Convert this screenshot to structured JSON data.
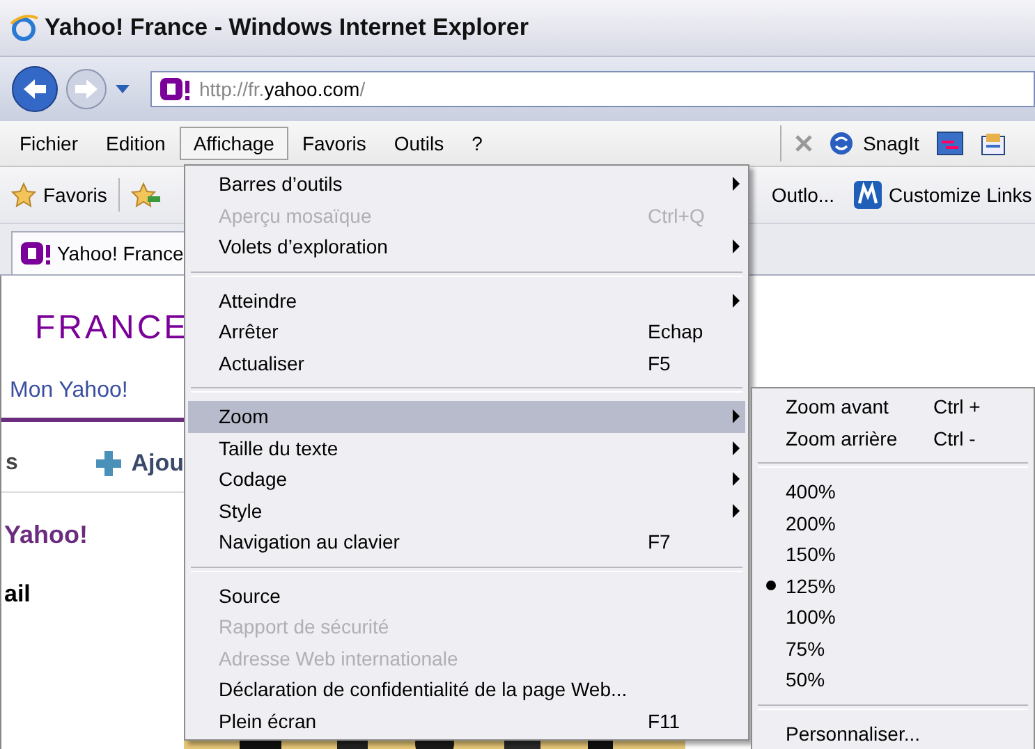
{
  "window": {
    "title": "Yahoo! France - Windows Internet Explorer"
  },
  "address_bar": {
    "scheme": "http://fr.",
    "domain": "yahoo.com",
    "path": "/"
  },
  "menu_bar": [
    {
      "label": "Fichier",
      "selected": false
    },
    {
      "label": "Edition",
      "selected": false
    },
    {
      "label": "Affichage",
      "selected": true
    },
    {
      "label": "Favoris",
      "selected": false
    },
    {
      "label": "Outils",
      "selected": false
    },
    {
      "label": "?",
      "selected": false
    }
  ],
  "toolbar": {
    "snagit_label": "SnagIt"
  },
  "favorites_bar": {
    "favorites_label": "Favoris",
    "links": [
      "Outlo...",
      "Customize Links"
    ]
  },
  "tabs": [
    {
      "label": "Yahoo! France",
      "selected": true
    }
  ],
  "page": {
    "logo_subtitle": "FRANCE",
    "nav_link": "Mon Yahoo!",
    "fragment": "s",
    "add_button": "Ajou",
    "heading": "Yahoo!",
    "label": "ail"
  },
  "view_menu": {
    "items": [
      {
        "kind": "item",
        "label": "Barres d’outils",
        "submenu": true,
        "disabled": false,
        "selected": false
      },
      {
        "kind": "item",
        "label": "Aperçu mosaïque",
        "shortcut": "Ctrl+Q",
        "submenu": false,
        "disabled": true,
        "selected": false
      },
      {
        "kind": "item",
        "label": "Volets d’exploration",
        "submenu": true,
        "disabled": false,
        "selected": false
      },
      {
        "kind": "separator"
      },
      {
        "kind": "item",
        "label": "Atteindre",
        "submenu": true,
        "disabled": false,
        "selected": false
      },
      {
        "kind": "item",
        "label": "Arrêter",
        "shortcut": "Echap",
        "submenu": false,
        "disabled": false,
        "selected": false
      },
      {
        "kind": "item",
        "label": "Actualiser",
        "shortcut": "F5",
        "submenu": false,
        "disabled": false,
        "selected": false
      },
      {
        "kind": "separator"
      },
      {
        "kind": "item",
        "label": "Zoom",
        "submenu": true,
        "disabled": false,
        "selected": true
      },
      {
        "kind": "item",
        "label": "Taille du texte",
        "submenu": true,
        "disabled": false,
        "selected": false
      },
      {
        "kind": "item",
        "label": "Codage",
        "submenu": true,
        "disabled": false,
        "selected": false
      },
      {
        "kind": "item",
        "label": "Style",
        "submenu": true,
        "disabled": false,
        "selected": false
      },
      {
        "kind": "item",
        "label": "Navigation au clavier",
        "shortcut": "F7",
        "submenu": false,
        "disabled": false,
        "selected": false
      },
      {
        "kind": "separator"
      },
      {
        "kind": "item",
        "label": "Source",
        "submenu": false,
        "disabled": false,
        "selected": false
      },
      {
        "kind": "item",
        "label": "Rapport de sécurité",
        "submenu": false,
        "disabled": true,
        "selected": false
      },
      {
        "kind": "item",
        "label": "Adresse Web internationale",
        "submenu": false,
        "disabled": true,
        "selected": false
      },
      {
        "kind": "item",
        "label": "Déclaration de confidentialité de la page Web...",
        "submenu": false,
        "disabled": false,
        "selected": false
      },
      {
        "kind": "item",
        "label": "Plein écran",
        "shortcut": "F11",
        "submenu": false,
        "disabled": false,
        "selected": false
      }
    ]
  },
  "zoom_submenu": {
    "items": [
      {
        "kind": "item",
        "label": "Zoom avant",
        "shortcut": "Ctrl +",
        "checked": false
      },
      {
        "kind": "item",
        "label": "Zoom arrière",
        "shortcut": "Ctrl -",
        "checked": false
      },
      {
        "kind": "separator"
      },
      {
        "kind": "item",
        "label": "400%",
        "checked": false
      },
      {
        "kind": "item",
        "label": "200%",
        "checked": false
      },
      {
        "kind": "item",
        "label": "150%",
        "checked": false
      },
      {
        "kind": "item",
        "label": "125%",
        "checked": true
      },
      {
        "kind": "item",
        "label": "100%",
        "checked": false
      },
      {
        "kind": "item",
        "label": "75%",
        "checked": false
      },
      {
        "kind": "item",
        "label": "50%",
        "checked": false
      },
      {
        "kind": "separator"
      },
      {
        "kind": "item",
        "label": "Personnaliser...",
        "checked": false
      }
    ]
  }
}
